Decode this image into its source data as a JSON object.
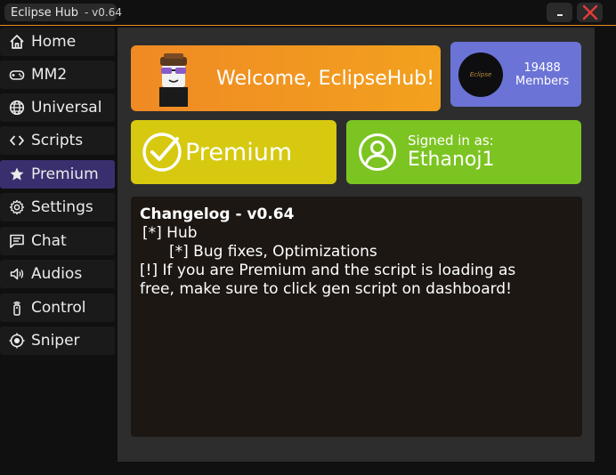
{
  "window": {
    "title": "Eclipse Hub",
    "version": "- v0.64",
    "minimize_label": "-",
    "close_label": "✕"
  },
  "colors": {
    "accent": "#f08a24",
    "active_nav": "#3a2f6e",
    "welcome": "#f08a24",
    "members": "#6b73d6",
    "premium": "#d6c910",
    "signed_in": "#7cc422"
  },
  "sidebar": {
    "items": [
      {
        "label": "Home",
        "icon": "home-icon"
      },
      {
        "label": "MM2",
        "icon": "gamepad-icon"
      },
      {
        "label": "Universal",
        "icon": "globe-icon"
      },
      {
        "label": "Scripts",
        "icon": "code-icon"
      },
      {
        "label": "Premium",
        "icon": "star-icon",
        "active": true
      },
      {
        "label": "Settings",
        "icon": "gear-icon"
      },
      {
        "label": "Chat",
        "icon": "chat-icon"
      },
      {
        "label": "Audios",
        "icon": "speaker-icon"
      },
      {
        "label": "Control",
        "icon": "remote-icon"
      },
      {
        "label": "Sniper",
        "icon": "target-icon"
      }
    ]
  },
  "main": {
    "welcome": "Welcome, EclipseHub!",
    "server": {
      "logo_text": "Eclipse",
      "count": "19488",
      "count_label": "Members"
    },
    "premium_label": "Premium",
    "signed_in": {
      "label": "Signed in as:",
      "username": "Ethanoj1"
    },
    "changelog": {
      "heading": "Changelog - v0.64",
      "lines": [
        "[*] Hub",
        "[*] Bug fixes, Optimizations",
        "[!] If you are Premium and the script is loading as",
        "free, make sure to click gen script on dashboard!"
      ]
    }
  }
}
